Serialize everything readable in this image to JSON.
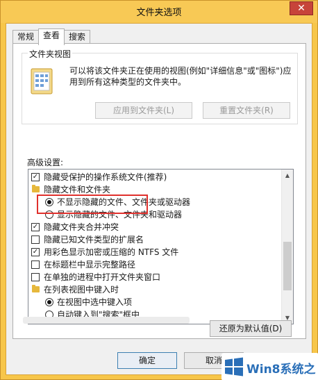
{
  "window": {
    "title": "文件夹选项",
    "close_glyph": "✕"
  },
  "tabs": [
    {
      "label": "常规",
      "active": false
    },
    {
      "label": "查看",
      "active": true
    },
    {
      "label": "搜索",
      "active": false
    }
  ],
  "folder_views": {
    "legend": "文件夹视图",
    "description": "可以将该文件夹正在使用的视图(例如\"详细信息\"或\"图标\")应用到所有这种类型的文件夹中。",
    "apply_button": "应用到文件夹(L)",
    "reset_button": "重置文件夹(R)"
  },
  "advanced": {
    "label": "高级设置:",
    "items": [
      {
        "type": "checkbox",
        "checked": true,
        "level": 1,
        "label": "隐藏受保护的操作系统文件(推荐)"
      },
      {
        "type": "folder",
        "level": 1,
        "label": "隐藏文件和文件夹"
      },
      {
        "type": "radio",
        "checked": true,
        "level": 2,
        "label": "不显示隐藏的文件、文件夹或驱动器"
      },
      {
        "type": "radio",
        "checked": false,
        "level": 2,
        "label": "显示隐藏的文件、文件夹和驱动器"
      },
      {
        "type": "checkbox",
        "checked": true,
        "level": 1,
        "label": "隐藏文件夹合并冲突"
      },
      {
        "type": "checkbox",
        "checked": false,
        "level": 1,
        "label": "隐藏已知文件类型的扩展名"
      },
      {
        "type": "checkbox",
        "checked": true,
        "level": 1,
        "label": "用彩色显示加密或压缩的 NTFS 文件"
      },
      {
        "type": "checkbox",
        "checked": false,
        "level": 1,
        "label": "在标题栏中显示完整路径"
      },
      {
        "type": "checkbox",
        "checked": false,
        "level": 1,
        "label": "在单独的进程中打开文件夹窗口"
      },
      {
        "type": "folder",
        "level": 1,
        "label": "在列表视图中键入时"
      },
      {
        "type": "radio",
        "checked": true,
        "level": 2,
        "label": "在视图中选中键入项"
      },
      {
        "type": "radio",
        "checked": false,
        "level": 2,
        "label": "自动键入到\"搜索\"框中"
      }
    ],
    "checkmark_glyph": "✓"
  },
  "restore_button": "还原为默认值(D)",
  "ok_button": "确定",
  "cancel_button": "取消",
  "watermark": {
    "text": "Win8系统之家"
  },
  "colors": {
    "window_frame": "#f7c64a",
    "close_button": "#c7443a",
    "highlight_box": "#e0302c",
    "watermark_text": "#2a6fb8"
  }
}
